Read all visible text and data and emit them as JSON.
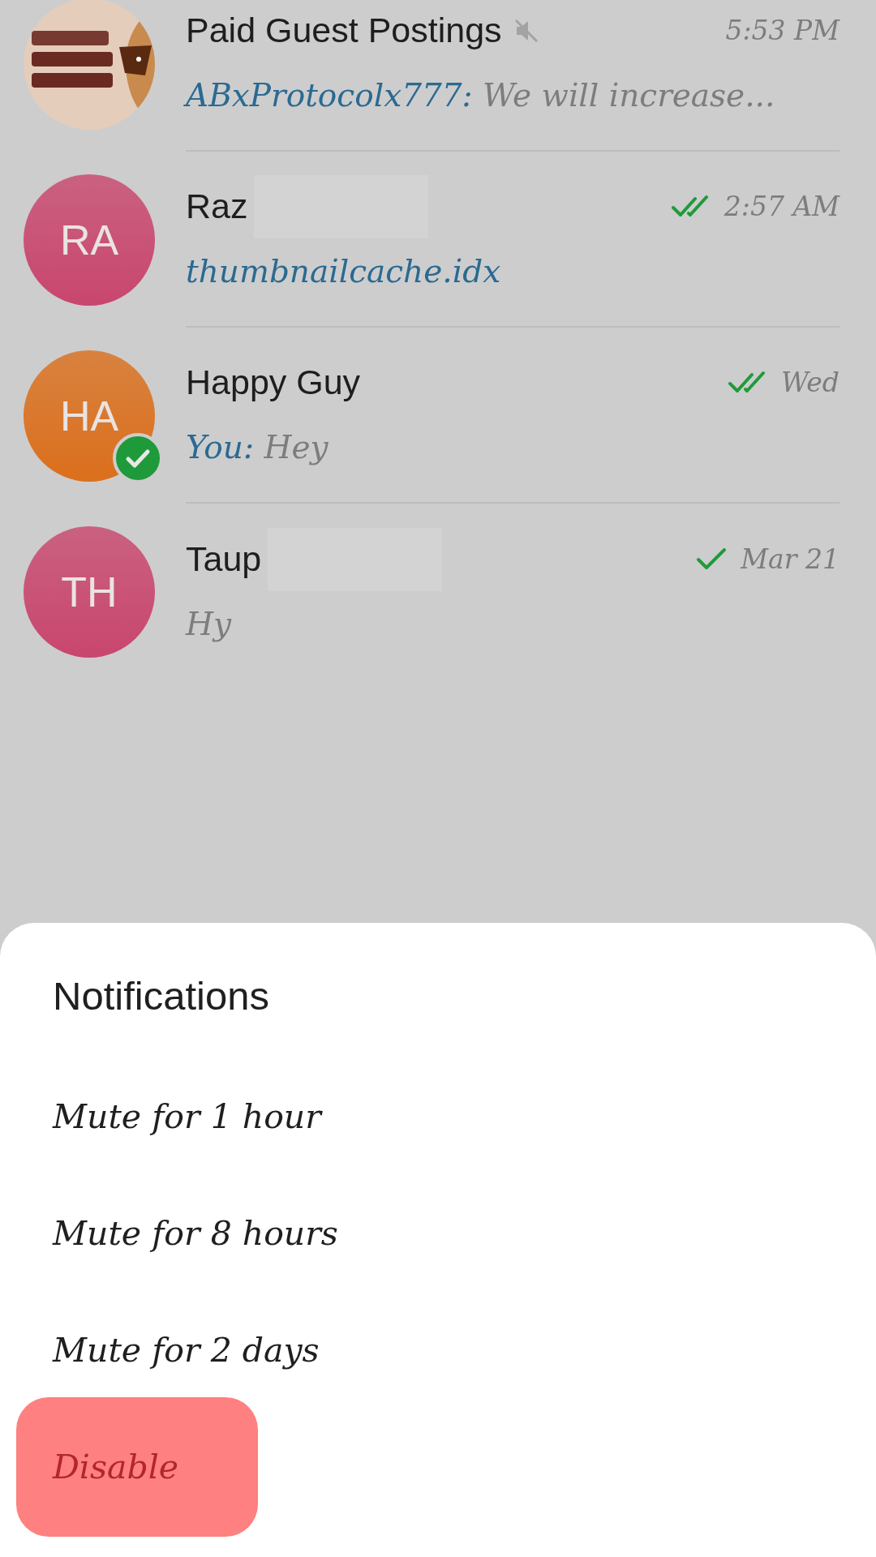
{
  "chats": [
    {
      "name": "Paid Guest Postings",
      "muted": true,
      "verified": false,
      "redacted": false,
      "sent": false,
      "read": false,
      "time": "5:53 PM",
      "preview": {
        "kind": "message",
        "sender": "ABxProtocolx777:",
        "text": "We will increase..."
      }
    },
    {
      "name": "Raz",
      "avatar": {
        "kind": "initials",
        "initials": "RA",
        "color": "#c9466e"
      },
      "muted": false,
      "verified": false,
      "redacted": true,
      "sent": true,
      "read": true,
      "time": "2:57 AM",
      "preview": {
        "kind": "file",
        "text": "thumbnailcache.idx"
      }
    },
    {
      "name": "Happy Guy",
      "avatar": {
        "kind": "initials",
        "initials": "HA",
        "color": "#db6f1c"
      },
      "muted": false,
      "verified": true,
      "redacted": false,
      "sent": true,
      "read": true,
      "time": "Wed",
      "preview": {
        "kind": "message",
        "sender": "You:",
        "text": "Hey"
      }
    },
    {
      "name": "Taup",
      "avatar": {
        "kind": "initials",
        "initials": "TH",
        "color": "#c9466e"
      },
      "muted": false,
      "verified": false,
      "redacted": true,
      "sent": true,
      "read": false,
      "time": "Mar 21",
      "preview": {
        "kind": "text",
        "text": "Hy"
      }
    }
  ],
  "sheet": {
    "title": "Notifications",
    "options": [
      {
        "label": "Mute for 1 hour",
        "kind": "normal",
        "highlighted": false
      },
      {
        "label": "Mute for 8 hours",
        "kind": "normal",
        "highlighted": false
      },
      {
        "label": "Mute for 2 days",
        "kind": "normal",
        "highlighted": false
      },
      {
        "label": "Disable",
        "kind": "danger",
        "highlighted": true
      }
    ]
  }
}
